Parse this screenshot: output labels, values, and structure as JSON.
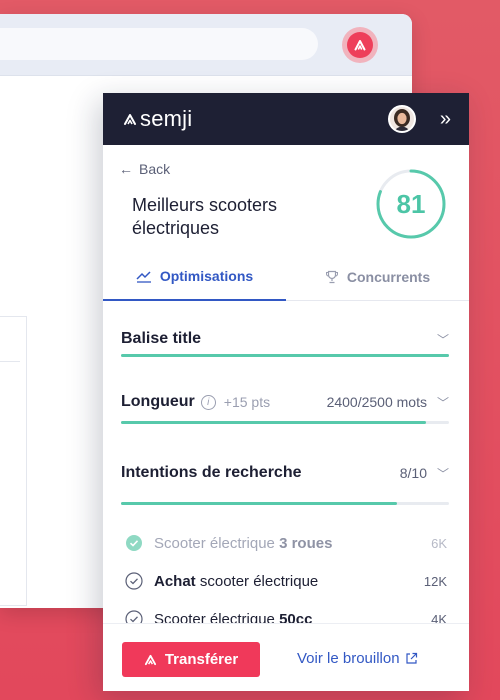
{
  "panel": {
    "brand": "semji",
    "back_label": "Back",
    "page_title": "Meilleurs scooters électriques",
    "score": "81",
    "score_fraction": 0.81,
    "tabs": [
      {
        "label": "Optimisations",
        "active": true
      },
      {
        "label": "Concurrents",
        "active": false
      }
    ],
    "sections": {
      "title_tag": {
        "label": "Balise title",
        "progress": 1.0
      },
      "length": {
        "label": "Longueur",
        "bonus": "+15 pts",
        "value": "2400/2500 mots",
        "progress": 0.93
      },
      "intents": {
        "label": "Intentions de recherche",
        "value": "8/10",
        "progress": 0.84
      }
    },
    "keywords": [
      {
        "prefix": "Scooter électrique ",
        "bold": "3 roues",
        "suffix": "",
        "volume": "6K",
        "done": true
      },
      {
        "prefix": "",
        "bold": "Achat",
        "suffix": " scooter électrique",
        "volume": "12K",
        "done": false
      },
      {
        "prefix": "Scooter électrique ",
        "bold": "50cc",
        "suffix": "",
        "volume": "4K",
        "done": false
      }
    ],
    "footer": {
      "transfer_label": "Transférer",
      "draft_label": "Voir le brouillon"
    }
  },
  "colors": {
    "background": "#e2485c",
    "header": "#1e2034",
    "accent_blue": "#3258c4",
    "accent_green": "#57c9ab",
    "brand_red": "#f0395a"
  },
  "icons": [
    "semji-logo-icon",
    "avatar",
    "collapse-icon",
    "back-arrow-icon",
    "trending-icon",
    "trophy-icon",
    "chevron-down-icon",
    "info-icon",
    "check-circle-icon",
    "external-link-icon"
  ]
}
